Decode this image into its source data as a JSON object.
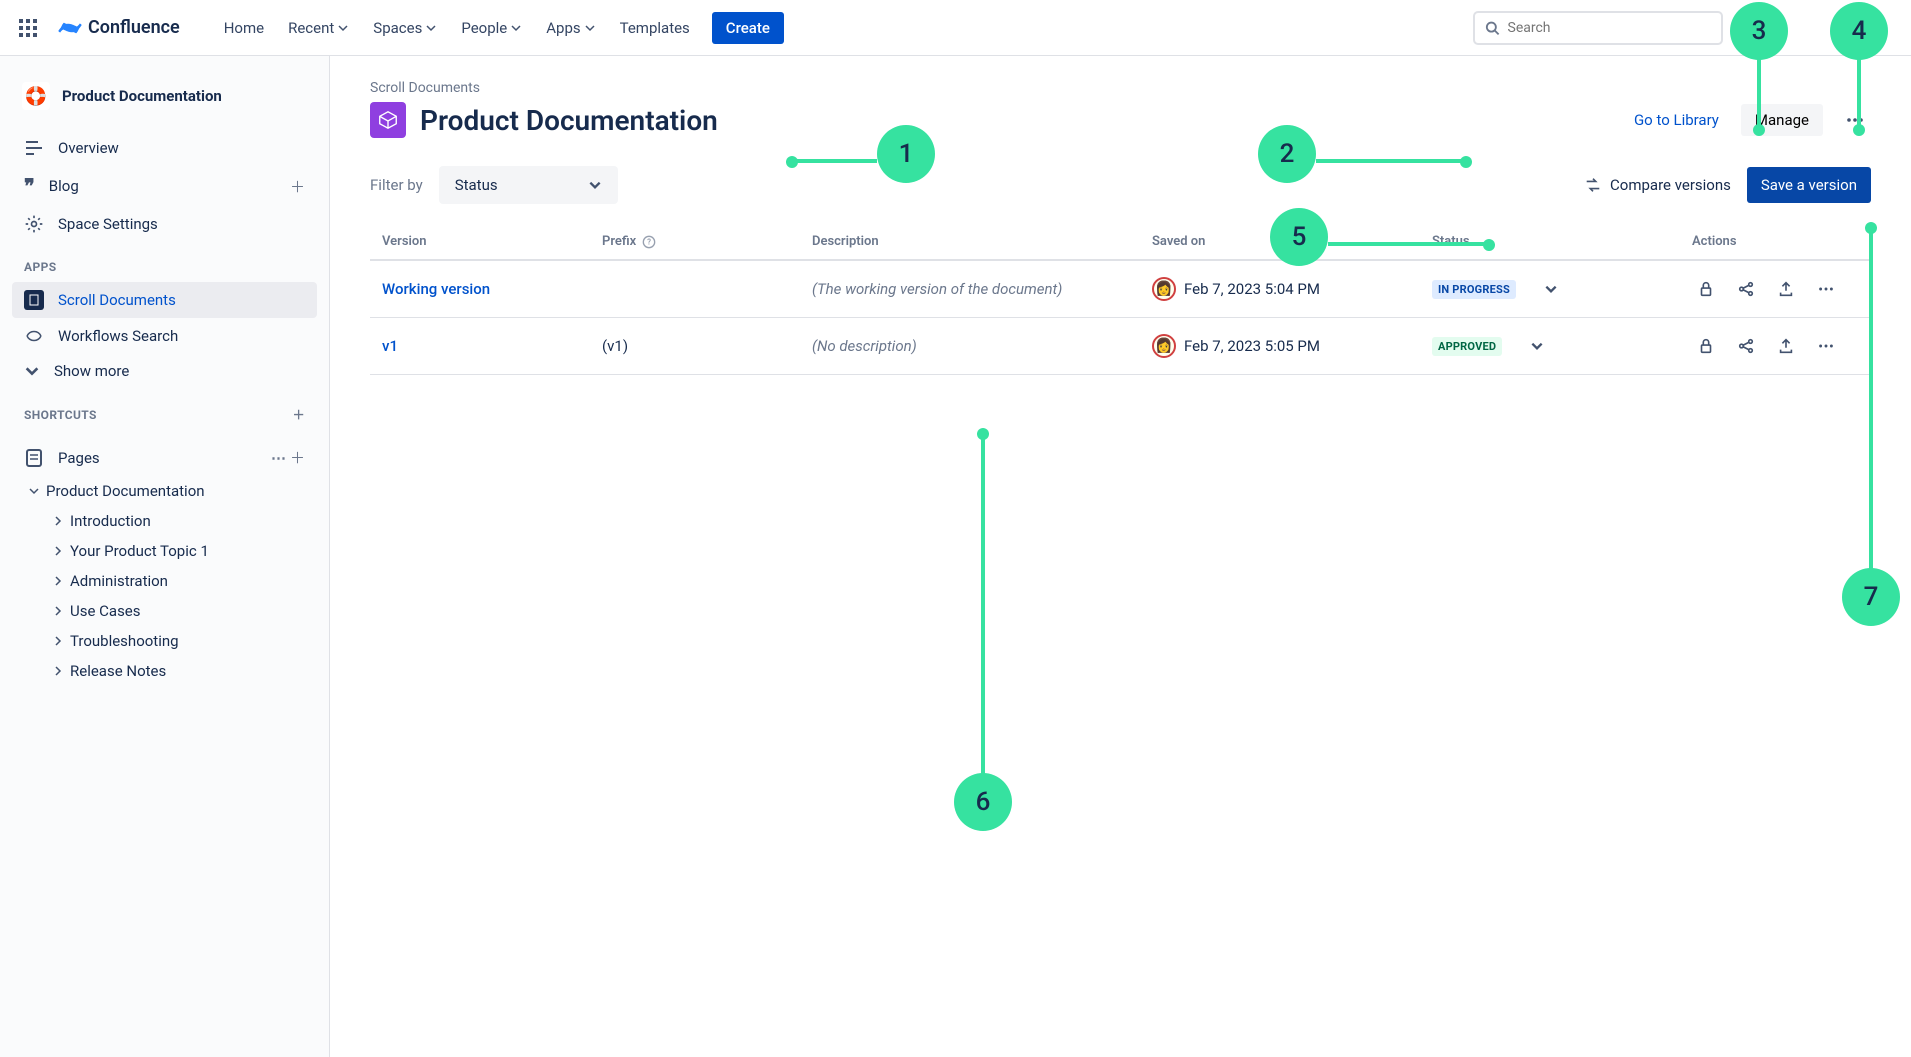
{
  "topnav": {
    "brand": "Confluence",
    "items": [
      "Home",
      "Recent",
      "Spaces",
      "People",
      "Apps",
      "Templates"
    ],
    "dropdowns": [
      false,
      true,
      true,
      true,
      true,
      false
    ],
    "create": "Create",
    "search_placeholder": "Search"
  },
  "sidebar": {
    "space": "Product Documentation",
    "items": [
      {
        "label": "Overview"
      },
      {
        "label": "Blog",
        "add": true
      },
      {
        "label": "Space Settings"
      }
    ],
    "apps_heading": "APPS",
    "apps": [
      {
        "label": "Scroll Documents",
        "active": true
      },
      {
        "label": "Workflows Search"
      },
      {
        "label": "Show more",
        "expand": true
      }
    ],
    "shortcuts_heading": "SHORTCUTS",
    "pages_label": "Pages",
    "tree_root": "Product Documentation",
    "tree_children": [
      "Introduction",
      "Your Product Topic 1",
      "Administration",
      "Use Cases",
      "Troubleshooting",
      "Release Notes"
    ]
  },
  "main": {
    "crumb": "Scroll Documents",
    "title": "Product Documentation",
    "go_library": "Go to Library",
    "manage": "Manage",
    "filter_label": "Filter by",
    "status_label": "Status",
    "compare": "Compare versions",
    "save": "Save a version",
    "columns": [
      "Version",
      "Prefix",
      "Description",
      "Saved on",
      "Status",
      "Actions"
    ],
    "rows": [
      {
        "name": "Working version",
        "prefix": "",
        "desc": "(The working version of the document)",
        "saved": "Feb 7, 2023 5:04 PM",
        "status": "IN PROGRESS",
        "status_kind": "inprogress"
      },
      {
        "name": "v1",
        "prefix": "(v1)",
        "desc": "(No description)",
        "saved": "Feb 7, 2023 5:05 PM",
        "status": "APPROVED",
        "status_kind": "approved"
      }
    ]
  },
  "callouts": [
    "1",
    "2",
    "3",
    "4",
    "5",
    "6",
    "7"
  ]
}
